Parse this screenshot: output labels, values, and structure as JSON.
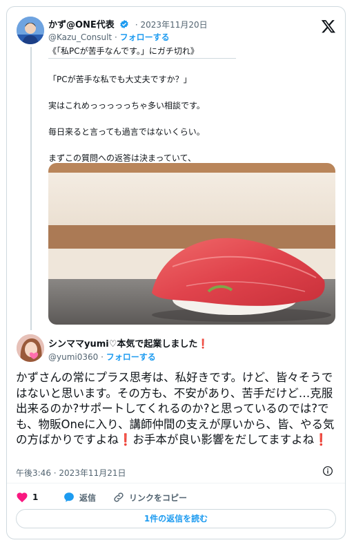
{
  "tweet": {
    "author_name": "かず@ONE代表",
    "date": "2023年11月20日",
    "handle": "@Kazu_Consult",
    "separator": "·",
    "follow_label": "フォローする",
    "quote_title": "《「私PCが苦手なんです。」にガチ切れ》",
    "lines": [
      "「PCが苦手な私でも大丈夫ですか？」",
      "実はこれめっっっっっちゃ多い相談です。",
      "毎日来ると言っても過言ではないくらい。",
      "まずこの質問への返答は決まっていて、"
    ]
  },
  "reply": {
    "author_name": "シンママyumi♡本気で起業しました",
    "author_suffix": "❗",
    "handle": "@yumi0360",
    "separator": "·",
    "follow_label": "フォローする",
    "text_parts": [
      "かずさんの常にプラス思考は、私好きです。けど、皆々そうではないと思います。その方も、不安があり、苦手だけど…克服出来るのか?サポートしてくれるのか?と思っているのでは?でも、物販Oneに入り、講師仲間の支えが厚いから、皆、やる気の方ばかりですよね",
      "❗",
      "お手本が良い影響をだしてますよね",
      "❗"
    ],
    "timestamp": "午後3:46 · 2023年11月21日",
    "like_count": "1",
    "reply_label": "返信",
    "copy_link_label": "リンクをコピー",
    "read_replies_label": "1件の返信を読む"
  },
  "colors": {
    "accent": "#1d9bf0",
    "like": "#f91880",
    "text": "#0f1419",
    "secondary": "#536471",
    "border": "#cfd9de"
  }
}
